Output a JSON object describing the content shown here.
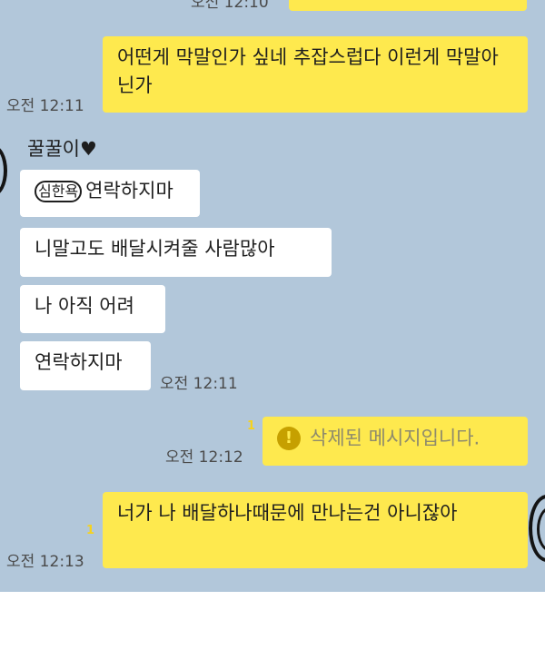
{
  "top": {
    "partial_time": "오전 12:10"
  },
  "messages": [
    {
      "id": "m1",
      "text": "어떤게 막말인가 싶네 추잡스럽다 이런게 막말아닌가",
      "time": "오전 12:11"
    },
    {
      "id": "m2",
      "sender": "꿀꿀이♥",
      "stamp": "심한욕",
      "text": "연락하지마"
    },
    {
      "id": "m3",
      "text": "니말고도 배달시켜줄 사람많아"
    },
    {
      "id": "m4",
      "text": "나 아직 어려"
    },
    {
      "id": "m5",
      "text": "연락하지마",
      "time": "오전 12:11"
    },
    {
      "id": "m6",
      "text": "삭제된 메시지입니다.",
      "time": "오전 12:12",
      "unread": "1",
      "icon": "warning-icon"
    },
    {
      "id": "m7",
      "text": "너가 나 배달하나때문에 만나는건 아니잖아",
      "time": "오전 12:13",
      "unread": "1"
    }
  ],
  "colors": {
    "background": "#b2c7da",
    "my_bubble": "#fee94e",
    "their_bubble": "#ffffff"
  }
}
